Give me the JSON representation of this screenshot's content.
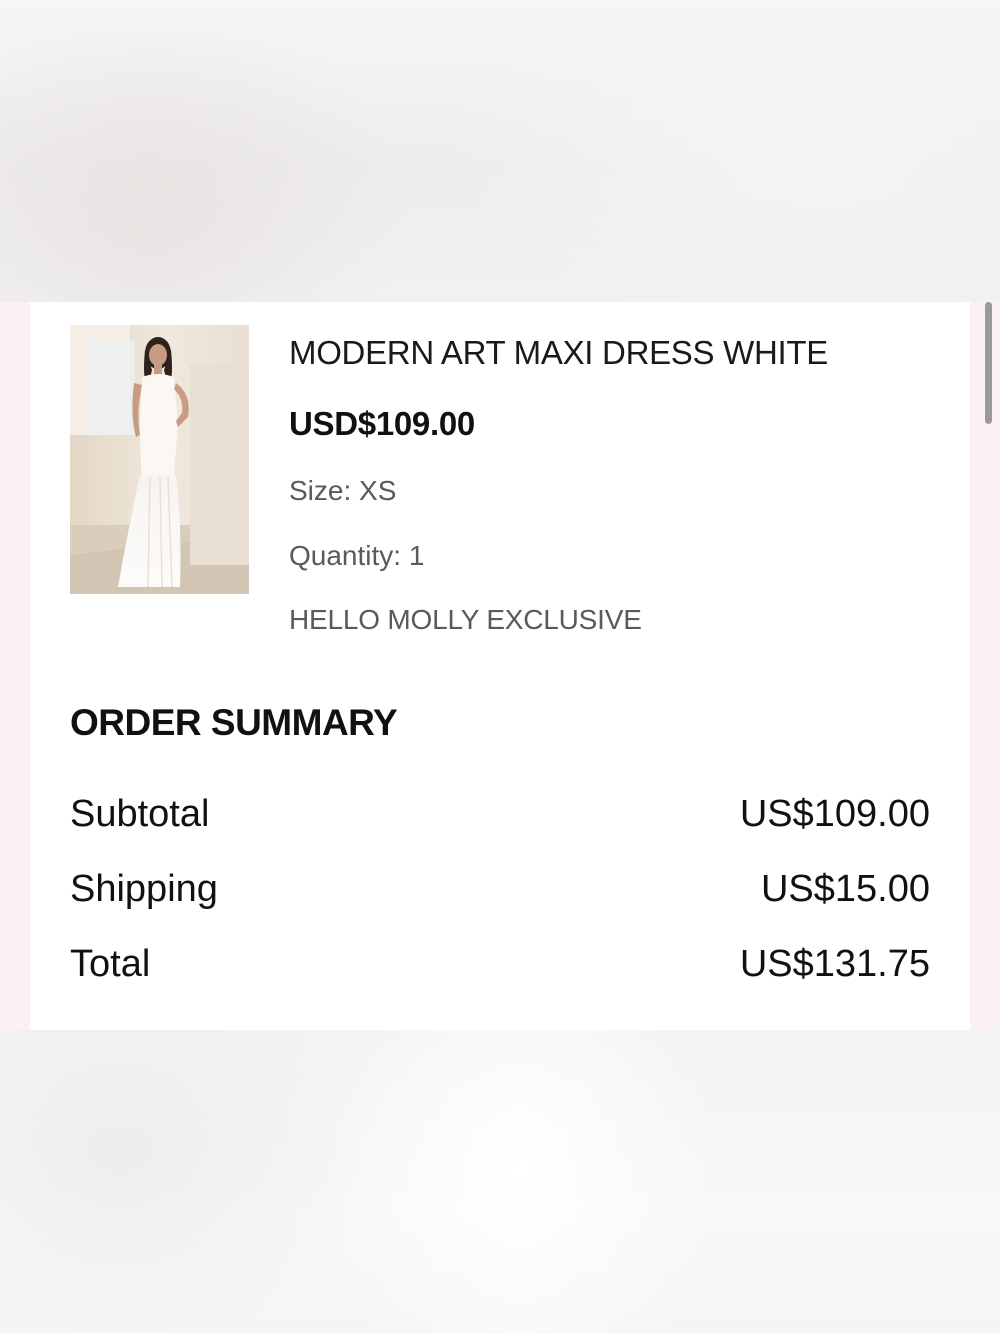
{
  "product": {
    "name": "MODERN ART MAXI DRESS WHITE",
    "price": "USD$109.00",
    "size": "Size: XS",
    "quantity": "Quantity: 1",
    "tag": "HELLO MOLLY EXCLUSIVE"
  },
  "summary": {
    "title": "ORDER SUMMARY",
    "rows": [
      {
        "label": "Subtotal",
        "value": "US$109.00"
      },
      {
        "label": "Shipping",
        "value": "US$15.00"
      },
      {
        "label": "Total",
        "value": "US$131.75"
      }
    ]
  },
  "colors": {
    "card_background": "#ffffff",
    "side_tint": "#fbf1f3",
    "primary_text": "#111111",
    "secondary_text": "#5a5a5a",
    "scrollbar": "#9a9a9a"
  }
}
